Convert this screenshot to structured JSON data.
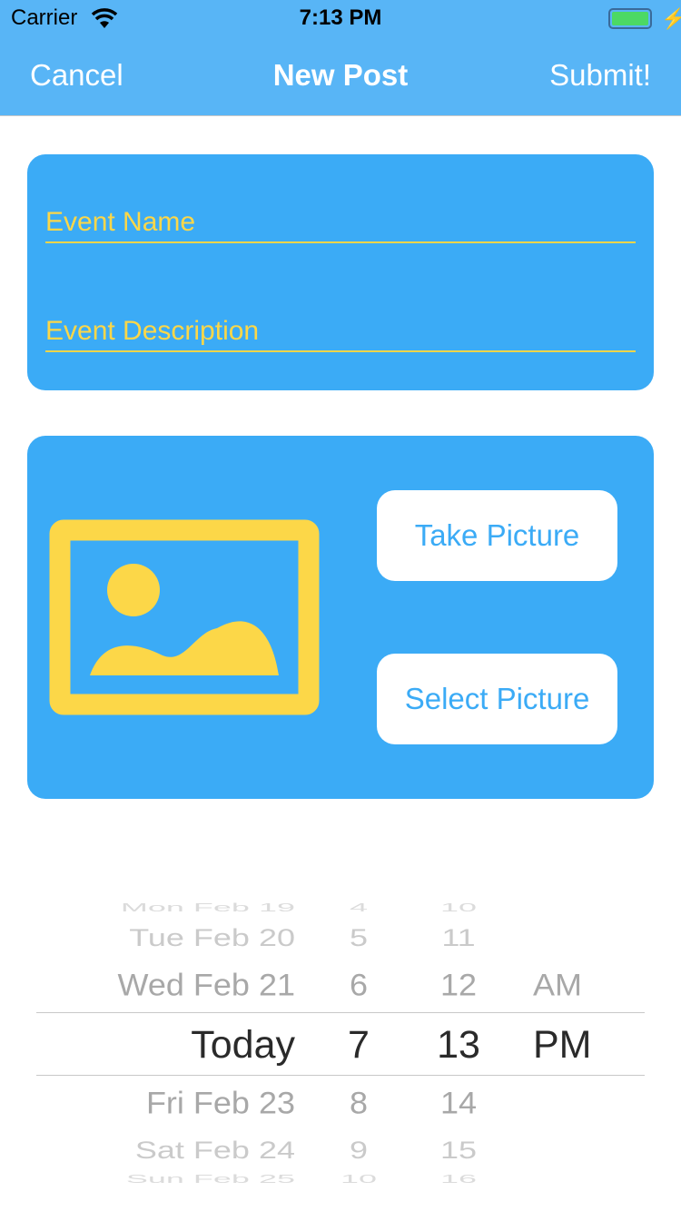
{
  "status": {
    "carrier": "Carrier",
    "time": "7:13 PM"
  },
  "nav": {
    "cancel": "Cancel",
    "title": "New Post",
    "submit": "Submit!"
  },
  "form": {
    "name_placeholder": "Event Name",
    "description_placeholder": "Event Description"
  },
  "picture": {
    "take": "Take Picture",
    "select": "Select Picture"
  },
  "picker": {
    "dates": [
      "Mon Feb 19",
      "Tue Feb 20",
      "Wed Feb 21",
      "Today",
      "Fri Feb 23",
      "Sat Feb 24",
      "Sun Feb 25"
    ],
    "hours": [
      "4",
      "5",
      "6",
      "7",
      "8",
      "9",
      "10"
    ],
    "minutes": [
      "10",
      "11",
      "12",
      "13",
      "14",
      "15",
      "16"
    ],
    "ampm": [
      "AM",
      "PM"
    ]
  },
  "colors": {
    "bar": "#58b5f6",
    "card": "#3babf6",
    "accent": "#fcd748"
  }
}
